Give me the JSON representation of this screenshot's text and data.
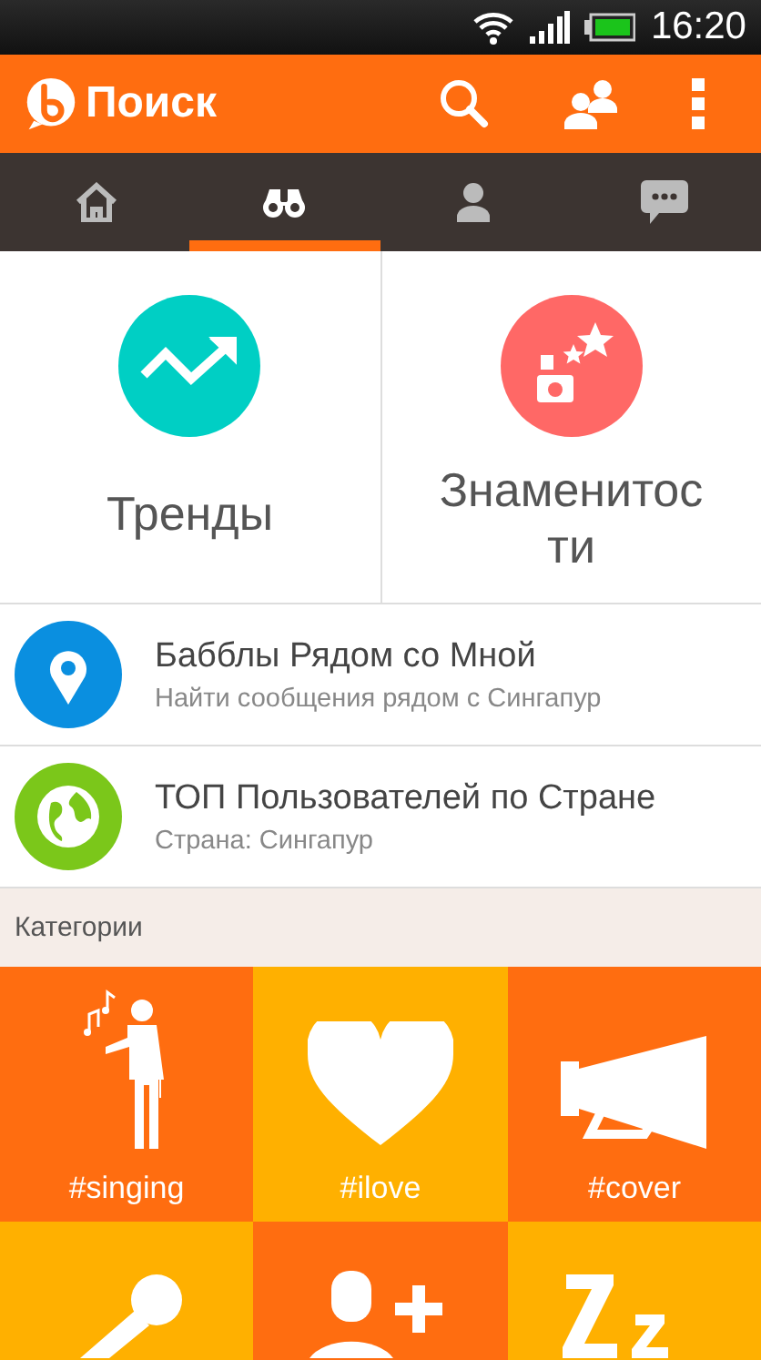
{
  "status_bar": {
    "time": "16:20"
  },
  "app_bar": {
    "title": "Поиск"
  },
  "tabs": [
    {
      "selected": false
    },
    {
      "selected": true
    },
    {
      "selected": false
    },
    {
      "selected": false
    }
  ],
  "feature_tiles": [
    {
      "label": "Тренды",
      "color": "#00cfc4"
    },
    {
      "label": "Знаменитости",
      "color": "#ff6866"
    }
  ],
  "list_rows": [
    {
      "title": "Бабблы Рядом со Мной",
      "subtitle": "Найти сообщения рядом с Сингапур",
      "color": "#0a8fe0"
    },
    {
      "title": "ТОП Пользователей по Стране",
      "subtitle": "Страна: Сингапур",
      "color": "#7bc71a"
    }
  ],
  "categories_header": "Категории",
  "categories": [
    {
      "label": "#singing",
      "color": "#ff6d10"
    },
    {
      "label": "#ilove",
      "color": "#ffb000"
    },
    {
      "label": "#cover",
      "color": "#ff6d10"
    },
    {
      "color": "#ffb000"
    },
    {
      "color": "#ff6d10"
    },
    {
      "color": "#ffb000"
    }
  ]
}
